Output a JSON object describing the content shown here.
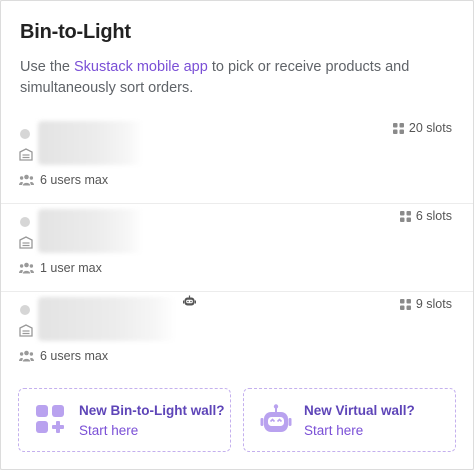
{
  "header": {
    "title": "Bin-to-Light",
    "desc_prefix": "Use the ",
    "desc_link": "Skustack mobile app",
    "desc_suffix": " to pick or receive products and simultaneously sort orders."
  },
  "walls": [
    {
      "slots": "20 slots",
      "users": "6 users max",
      "virtual": false
    },
    {
      "slots": "6 slots",
      "users": "1 user max",
      "virtual": false
    },
    {
      "slots": "9 slots",
      "users": "6 users max",
      "virtual": true
    }
  ],
  "new_actions": [
    {
      "title": "New Bin-to-Light wall?",
      "subtitle": "Start here",
      "icon": "grid-plus-icon"
    },
    {
      "title": "New Virtual wall?",
      "subtitle": "Start here",
      "icon": "robot-icon"
    }
  ],
  "colors": {
    "accent": "#7a4fd6",
    "icon_bg": "#b9a2ef",
    "border_dashed": "#c4b0ee"
  }
}
